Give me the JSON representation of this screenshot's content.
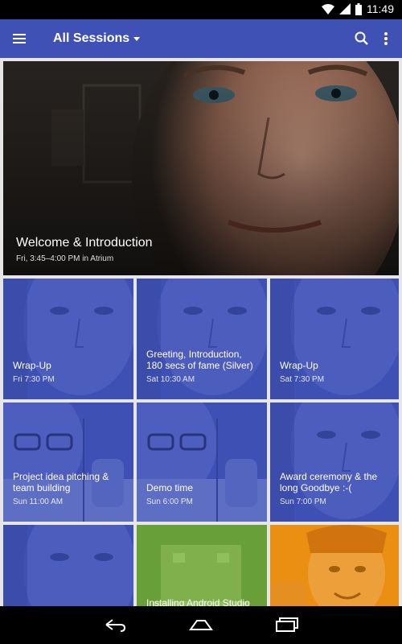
{
  "status_bar": {
    "time": "11:49"
  },
  "app_bar": {
    "title": "All Sessions"
  },
  "colors": {
    "primary": "#3f51b5",
    "green": "#689f38",
    "orange": "#ff9800"
  },
  "hero": {
    "title": "Welcome & Introduction",
    "subtitle": "Fri, 3:45–4:00 PM in Atrium"
  },
  "sessions": [
    {
      "title": "Wrap-Up",
      "time": "Fri 7:30 PM"
    },
    {
      "title": "Greeting, Introduction, 180 secs of fame (Silver)",
      "time": "Sat 10:30 AM"
    },
    {
      "title": "Wrap-Up",
      "time": "Sat 7:30 PM"
    },
    {
      "title": "Project idea pitching & team building",
      "time": "Sun 11:00 AM"
    },
    {
      "title": "Demo time",
      "time": "Sun 6:00 PM"
    },
    {
      "title": "Award ceremony & the long Goodbye :-(",
      "time": "Sun 7:00 PM"
    },
    {
      "title": "",
      "time": ""
    },
    {
      "title": "Installing Android Studio",
      "time": ""
    },
    {
      "title": "",
      "time": ""
    }
  ],
  "icons": {
    "status": [
      "wifi-icon",
      "signal-icon",
      "battery-icon"
    ],
    "app_bar": [
      "menu-icon",
      "dropdown-arrow-icon",
      "search-icon",
      "more-vert-icon"
    ],
    "nav": [
      "back-icon",
      "home-icon",
      "recents-icon"
    ]
  }
}
